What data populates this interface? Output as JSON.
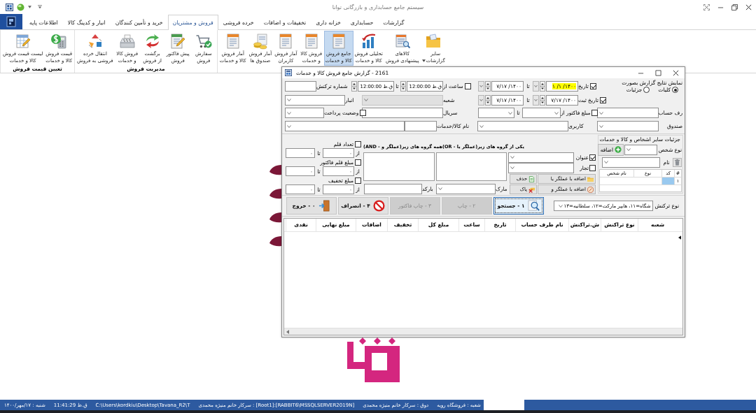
{
  "window": {
    "title": "سیستم جامع حسابداری و بازرگانی توانا"
  },
  "ribbon_tabs": [
    {
      "label": "گزارشات",
      "selected": false
    },
    {
      "label": "حسابداری",
      "selected": false
    },
    {
      "label": "خزانه داری",
      "selected": false
    },
    {
      "label": "تخفیفات و اضافات",
      "selected": false
    },
    {
      "label": "خرده فروشی",
      "selected": false
    },
    {
      "label": "فروش و مشتریان",
      "selected": true
    },
    {
      "label": "خرید و تأمین کنندگان",
      "selected": false
    },
    {
      "label": "انبار و کدینگ کالا",
      "selected": false
    },
    {
      "label": "اطلاعات پایه",
      "selected": false
    }
  ],
  "ribbon_groups": [
    {
      "buttons": [
        {
          "label": "سایر\nگزارشات",
          "selected": false,
          "dropdown": true
        },
        {
          "label": "کالاهای\nپیشنهادی فروش",
          "selected": false,
          "dropdown": false
        },
        {
          "label": "تحلیلی فروش\nکالا و خدمات",
          "selected": false,
          "dropdown": false
        },
        {
          "label": "جامع فروش\nکالا و خدمات",
          "selected": true,
          "dropdown": false
        },
        {
          "label": "فروش کالا\nو خدمات",
          "selected": false,
          "dropdown": false
        },
        {
          "label": "آمار فروش\nکاربران",
          "selected": false,
          "dropdown": false
        },
        {
          "label": "آمار فروش\nصندوق ها",
          "selected": false,
          "dropdown": false
        },
        {
          "label": "آمار فروش\nکالا و خدمات",
          "selected": false,
          "dropdown": false
        }
      ]
    },
    {
      "label": "مدیریت فروش",
      "buttons": [
        {
          "label": "سفارش\nفروش",
          "selected": false,
          "dropdown": false
        },
        {
          "label": "پیش فاکتور\nفروش",
          "selected": false,
          "dropdown": false
        },
        {
          "label": "برگشت\nاز فروش",
          "selected": false,
          "dropdown": false
        },
        {
          "label": "فروش کالا\nو خدمات",
          "selected": false,
          "dropdown": false
        },
        {
          "label": "انتقال خرده\nفروشی به فروش",
          "selected": false,
          "dropdown": false
        }
      ]
    },
    {
      "label": "تعیین قیمت فروش",
      "buttons": [
        {
          "label": "قیمت فروش\nکالا و خدمات",
          "selected": false,
          "dropdown": false
        },
        {
          "label": "لیست قیمت فروش\nکالا و خدمات",
          "selected": false,
          "dropdown": false
        }
      ]
    }
  ],
  "dialog": {
    "title": "2161 - گزارش جامع فروش کالا و خدمات",
    "report_mode": {
      "label": "نمایش نتایج گزارش بصورت",
      "options": [
        {
          "label": "کلیات",
          "selected": true
        },
        {
          "label": "جزئیات",
          "selected": false
        }
      ]
    },
    "date": {
      "label": "تاریخ",
      "checked": true,
      "from": "۱۴۰۰/ ۱/ ۱",
      "from_highlighted": true,
      "to_label": "تا",
      "to": "۱۴۰۰/ ۷/۱۷"
    },
    "time": {
      "label": "ساعت از",
      "checked": false,
      "from": "ق.ظ 12:00:00",
      "to_label": "تا",
      "to": "ق.ظ 12:00:00"
    },
    "transaction_number": {
      "label": "شماره ترکنش"
    },
    "register_date": {
      "label": "تاریخ ثبت",
      "checked": true,
      "from": "۱۴۰۰/ ۷/۱۷",
      "from_highlighted": false,
      "to_label": "تا",
      "to": "۱۴۰۰/ ۷/۱۷"
    },
    "branch": {
      "label": "شعبه",
      "disabled": true
    },
    "warehouse": {
      "label": "انبار"
    },
    "account": {
      "label": "رف حساب"
    },
    "invoice_amount": {
      "label": "مبلغ فاکتور از",
      "checked": false,
      "to_label": "تا"
    },
    "serial": {
      "label": "سریال"
    },
    "payment_status": {
      "label": "وضعیت پرداخت",
      "checked": false
    },
    "cashbox": {
      "label": "صندوق"
    },
    "user": {
      "label": "کاربری"
    },
    "product": {
      "label": "نام کالا/خدمات"
    },
    "persons": {
      "title": "جزئیات سایر اشخاص و کالا و خدمات",
      "type_label": "نوع شخص",
      "add_button": "اضافه",
      "name_label": "نام",
      "columns": [
        "#",
        "کد",
        "نوع",
        "نام شخص"
      ],
      "rows": [
        {
          "number": "۱",
          "selected": true
        }
      ]
    },
    "groups": {
      "filters": [
        {
          "label": "عنوان",
          "checked": true
        },
        {
          "label": "تجار",
          "checked": false
        }
      ],
      "buttons": [
        "اضافه با عملگر یا",
        "حذف",
        "اضافه با عملگر و",
        "پاک"
      ],
      "any_label": "یکی از گروه های زیر(عملگر یا - OR)",
      "all_label": "همه گروه های زیر(عملگر و - AND)",
      "brand_label": "مارک",
      "barcode_label": "بارکد"
    },
    "amount_filters": [
      {
        "label": "تعداد قلم",
        "checked": false,
        "from_label": "از",
        "from": "۰",
        "to_label": "تا",
        "to": "۰"
      },
      {
        "label": "مبلغ قلم فاکتور",
        "checked": false,
        "from_label": "از",
        "from": "۰",
        "to_label": "تا",
        "to": "۰"
      },
      {
        "label": "مبلغ تخفیف",
        "checked": false,
        "from_label": "از",
        "from": "۰",
        "to_label": "تا",
        "to": "۰"
      }
    ],
    "transaction_type": {
      "label": "نوع ترکنش",
      "value": "شگاه=۱۱، هایپر مارکت=۱۲، سلطانیه=۱۳"
    },
    "actions": [
      {
        "label": "۱ - جستجو",
        "disabled": false,
        "focused": true
      },
      {
        "label": "۲ - چاپ",
        "disabled": true,
        "focused": false
      },
      {
        "label": "۳ - چاپ فاکتور",
        "disabled": true,
        "focused": false
      },
      {
        "label": "۴ - انصراف",
        "disabled": false,
        "focused": false
      },
      {
        "label": "۰ - خروج",
        "disabled": false,
        "focused": false
      }
    ],
    "table": {
      "columns": [
        "شعبه",
        "نوع تراکنش",
        "ش.تراکنش",
        "نام طرف حساب",
        "تاریخ",
        "ساعت",
        "مبلغ کل",
        "تخفیف",
        "اضافات",
        "مبلغ نهایی",
        "نقدی"
      ]
    }
  },
  "status_bar": {
    "items": [
      "شعبه : فروشگاه رویه",
      "دوق : سرکار خانم منیژه محمدی",
      "[RABBIT6\\MSSQLSERVER2019N]:[Root1] : سرکار خانم منیژه محمدی",
      "C:\\Users\\kordkiu\\Desktop\\Tavana_R2\\T",
      "ق.ظ 11:41:29",
      "شنبه : ۱۷/مهر/۱۴۰۰"
    ]
  }
}
